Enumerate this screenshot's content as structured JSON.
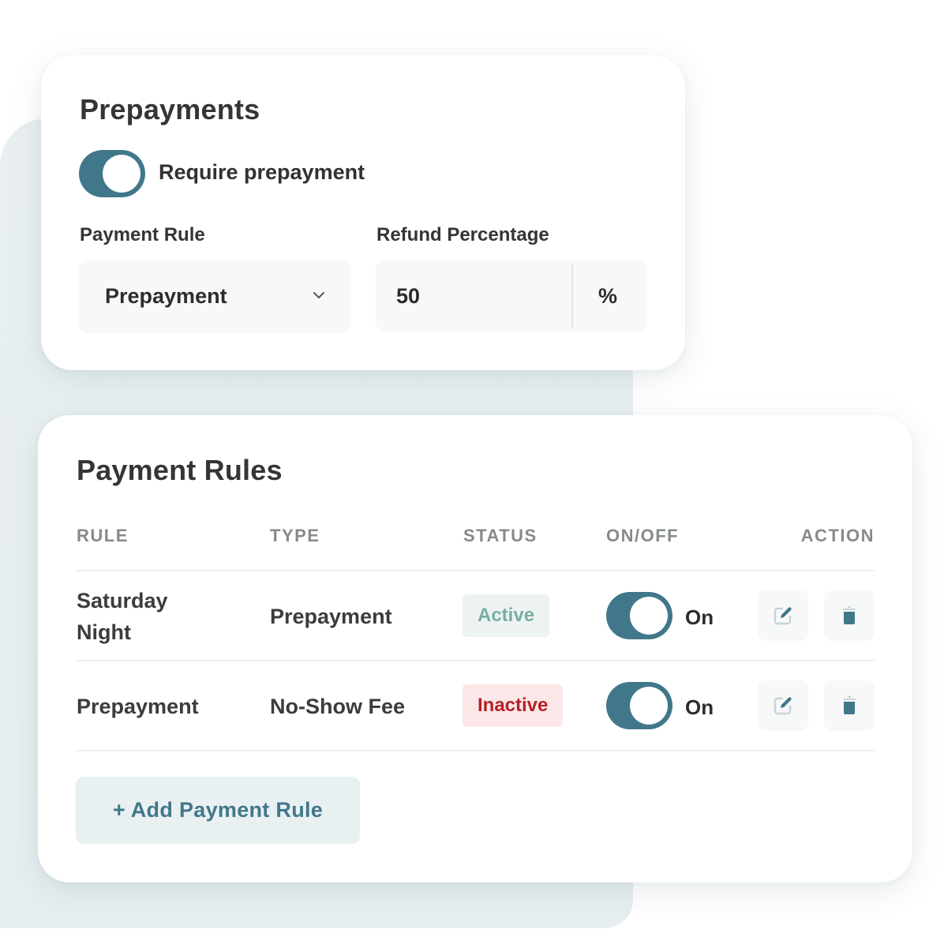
{
  "prepayments": {
    "title": "Prepayments",
    "require_toggle": {
      "label": "Require prepayment",
      "on": true
    },
    "payment_rule": {
      "label": "Payment Rule",
      "value": "Prepayment"
    },
    "refund_percentage": {
      "label": "Refund Percentage",
      "value": "50",
      "unit": "%"
    }
  },
  "payment_rules": {
    "title": "Payment Rules",
    "columns": [
      "RULE",
      "TYPE",
      "STATUS",
      "ON/OFF",
      "ACTION"
    ],
    "rows": [
      {
        "rule_line1": "Saturday",
        "rule_line2": "Night",
        "type": "Prepayment",
        "status": "Active",
        "toggle_on": true,
        "toggle_label": "On"
      },
      {
        "rule_line1": "Prepayment",
        "rule_line2": "",
        "type": "No-Show Fee",
        "status": "Inactive",
        "toggle_on": true,
        "toggle_label": "On"
      }
    ],
    "add_button_label": "+ Add Payment Rule"
  },
  "colors": {
    "accent": "#41778a",
    "active_text": "#78aea0",
    "active_bg": "#edf3f3",
    "inactive_text": "#b52126",
    "inactive_bg": "#fbe7e8"
  },
  "icons": {
    "edit": "edit-icon",
    "delete": "trash-icon",
    "dropdown": "chevron-down-icon"
  }
}
